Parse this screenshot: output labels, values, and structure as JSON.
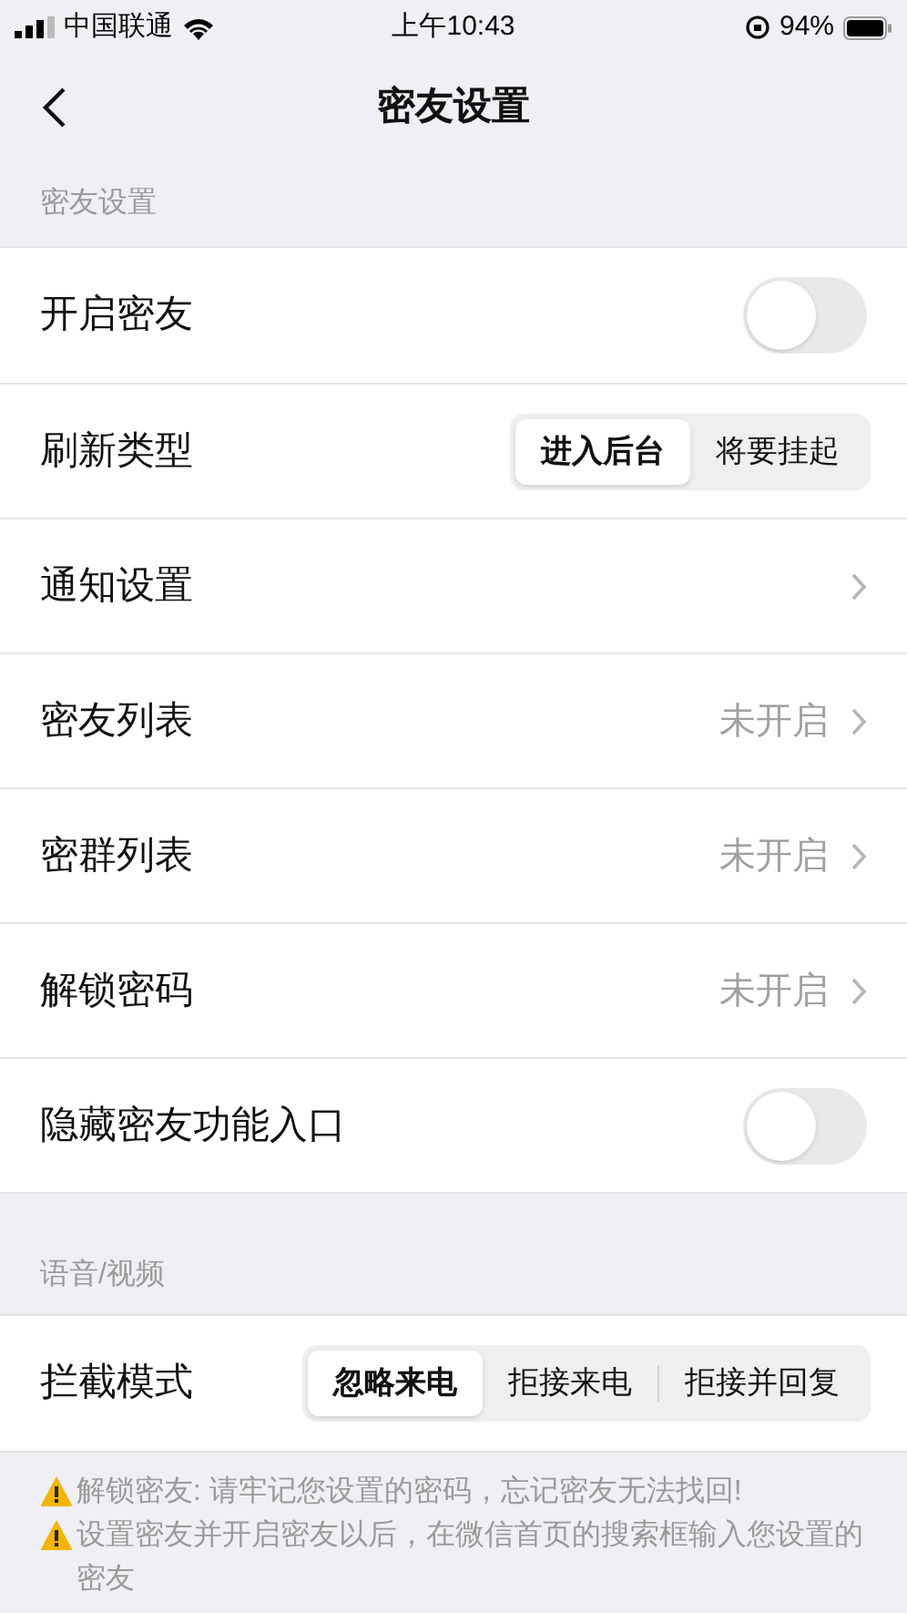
{
  "status_bar": {
    "carrier": "中国联通",
    "time": "上午10:43",
    "battery": "94%"
  },
  "nav": {
    "title": "密友设置"
  },
  "sections": [
    {
      "header": "密友设置",
      "rows": [
        {
          "kind": "toggle",
          "label": "开启密友",
          "on": false
        },
        {
          "kind": "segment",
          "label": "刷新类型",
          "options": [
            {
              "label": "进入后台",
              "selected": true
            },
            {
              "label": "将要挂起",
              "selected": false
            }
          ]
        },
        {
          "kind": "link",
          "label": "通知设置"
        },
        {
          "kind": "link",
          "label": "密友列表",
          "value": "未开启"
        },
        {
          "kind": "link",
          "label": "密群列表",
          "value": "未开启"
        },
        {
          "kind": "link",
          "label": "解锁密码",
          "value": "未开启"
        },
        {
          "kind": "toggle",
          "label": "隐藏密友功能入口",
          "on": false
        }
      ]
    },
    {
      "header": "语音/视频",
      "rows": [
        {
          "kind": "segment",
          "label": "拦截模式",
          "options": [
            {
              "label": "忽略来电",
              "selected": true
            },
            {
              "label": "拒接来电",
              "selected": false
            },
            {
              "label": "拒接并回复",
              "selected": false
            }
          ]
        }
      ]
    }
  ],
  "notes": [
    "解锁密友: 请牢记您设置的密码，忘记密友无法找回!",
    "设置密友并开启密友以后，在微信首页的搜索框输入您设置的密友"
  ]
}
